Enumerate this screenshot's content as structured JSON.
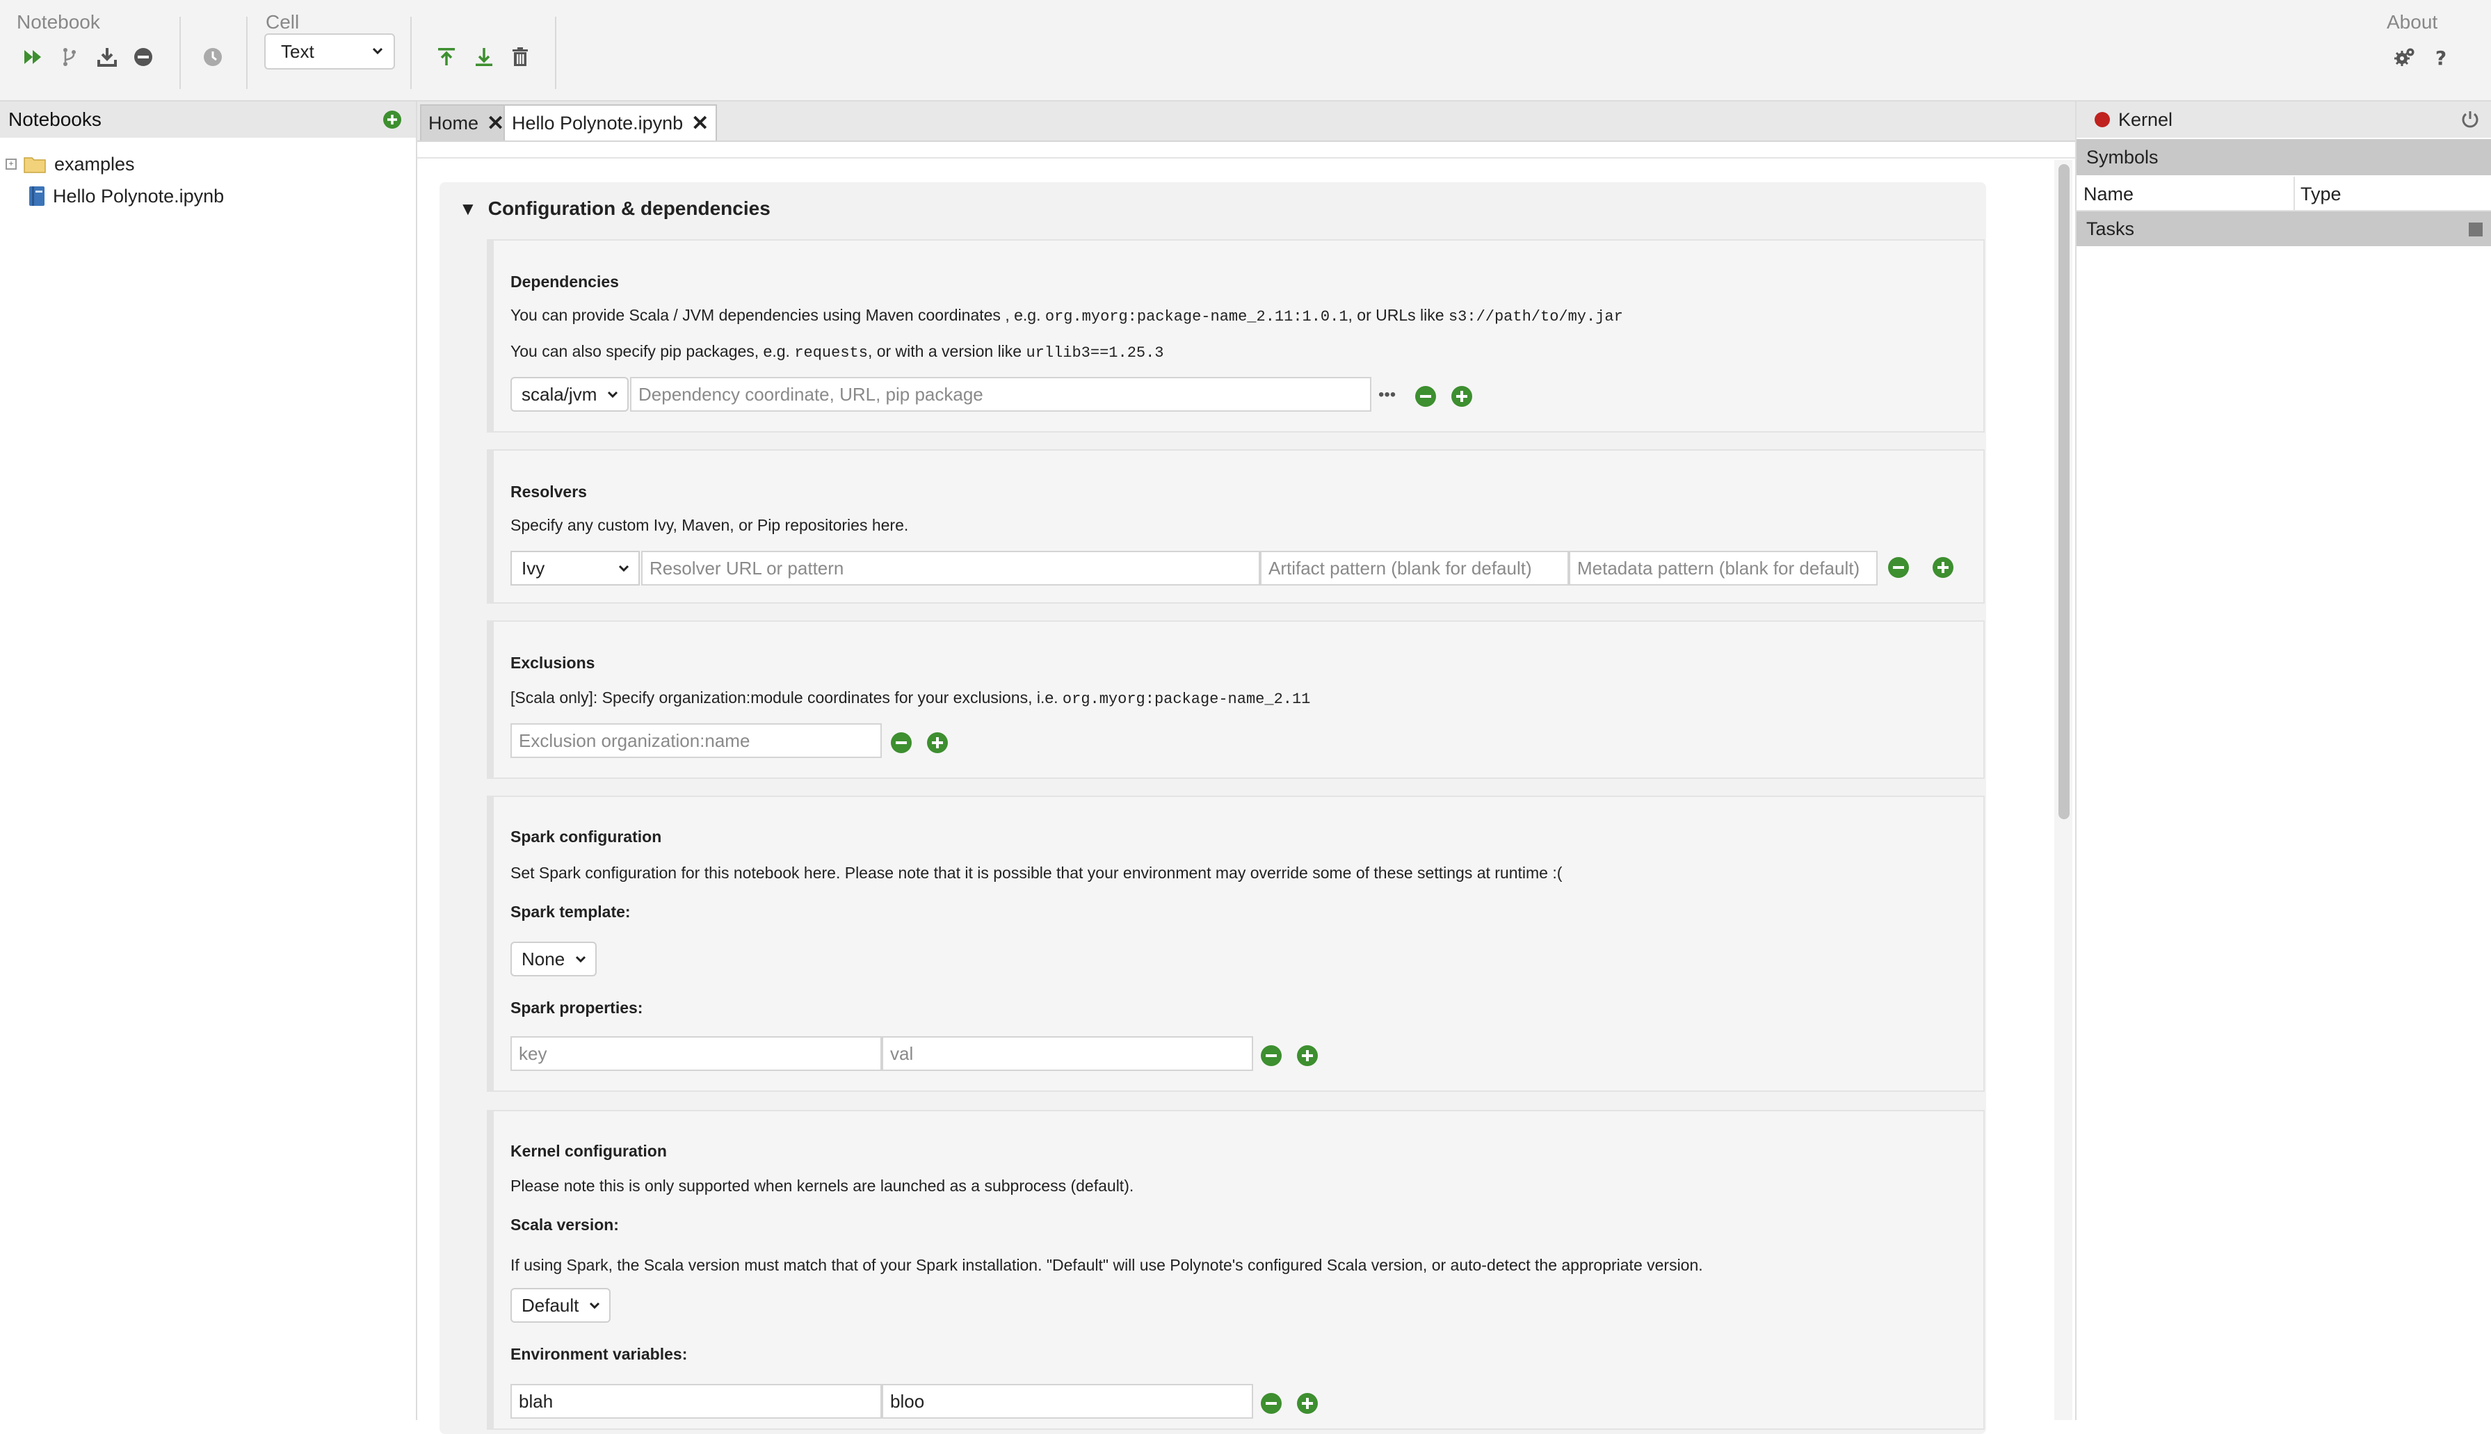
{
  "toolbar": {
    "notebook_label": "Notebook",
    "cell_label": "Cell",
    "about_label": "About",
    "cell_type_value": "Text",
    "notebook_icons": [
      "run-all-icon",
      "branch-icon",
      "download-icon",
      "clear-output-icon",
      "schedule-icon"
    ],
    "cell_icons": [
      "insert-above-icon",
      "insert-below-icon",
      "delete-icon"
    ],
    "about_icons": [
      "settings-icon",
      "help-icon"
    ]
  },
  "left_panel": {
    "title": "Notebooks",
    "tree": [
      {
        "label": "examples",
        "type": "folder"
      },
      {
        "label": "Hello Polynote.ipynb",
        "type": "notebook"
      }
    ]
  },
  "tabs": [
    {
      "label": "Home",
      "active": false
    },
    {
      "label": "Hello Polynote.ipynb",
      "active": true
    }
  ],
  "config": {
    "title": "Configuration & dependencies",
    "dependencies": {
      "heading": "Dependencies",
      "line1_a": "You can provide Scala / JVM dependencies using Maven coordinates , e.g.",
      "line1_code1": "org.myorg:package-name_2.11:1.0.1",
      "line1_b": ", or URLs like",
      "line1_code2": "s3://path/to/my.jar",
      "line2_a": "You can also specify pip packages, e.g.",
      "line2_code1": "requests",
      "line2_b": ", or with a version like",
      "line2_code2": "urllib3==1.25.3",
      "type_value": "scala/jvm",
      "placeholder": "Dependency coordinate, URL, pip package",
      "more": "•••"
    },
    "resolvers": {
      "heading": "Resolvers",
      "text": "Specify any custom Ivy, Maven, or Pip repositories here.",
      "type_value": "Ivy",
      "url_placeholder": "Resolver URL or pattern",
      "artifact_placeholder": "Artifact pattern (blank for default)",
      "metadata_placeholder": "Metadata pattern (blank for default)"
    },
    "exclusions": {
      "heading": "Exclusions",
      "text": "[Scala only]: Specify organization:module coordinates for your exclusions, i.e.",
      "code": "org.myorg:package-name_2.11",
      "placeholder": "Exclusion organization:name"
    },
    "spark": {
      "heading": "Spark configuration",
      "text": "Set Spark configuration for this notebook here. Please note that it is possible that your environment may override some of these settings at runtime :(",
      "template_label": "Spark template:",
      "template_value": "None",
      "properties_label": "Spark properties:",
      "key_placeholder": "key",
      "val_placeholder": "val"
    },
    "kernel": {
      "heading": "Kernel configuration",
      "text": "Please note this is only supported when kernels are launched as a subprocess (default).",
      "scala_label": "Scala version:",
      "scala_text": "If using Spark, the Scala version must match that of your Spark installation. \"Default\" will use Polynote's configured Scala version, or auto-detect the appropriate version.",
      "scala_value": "Default",
      "env_label": "Environment variables:",
      "env_key": "blah",
      "env_val": "bloo"
    }
  },
  "right_panel": {
    "kernel_label": "Kernel",
    "kernel_status_color": "#c0221f",
    "symbols_label": "Symbols",
    "col_name": "Name",
    "col_type": "Type",
    "tasks_label": "Tasks"
  },
  "colors": {
    "accent_green": "#3d8f2f",
    "icon_gray": "#6b6b6b"
  }
}
